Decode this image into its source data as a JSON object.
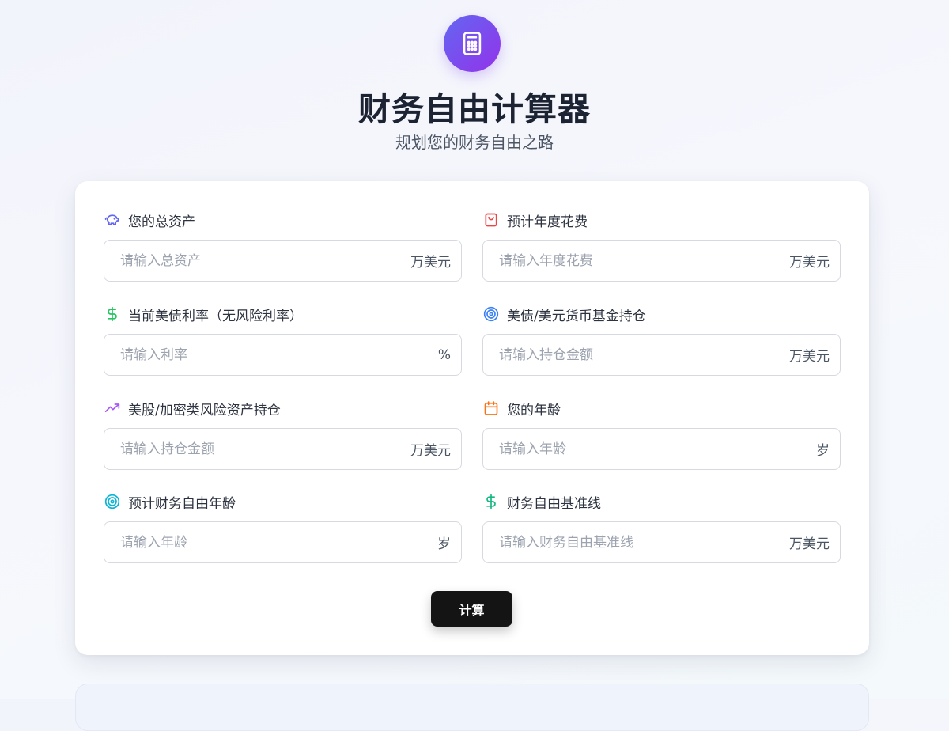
{
  "header": {
    "title": "财务自由计算器",
    "subtitle": "规划您的财务自由之路",
    "logo_icon": "calculator-icon"
  },
  "colors": {
    "accent_start": "#6366f1",
    "accent_end": "#9333ea",
    "button_bg": "#141414"
  },
  "form": {
    "fields": [
      {
        "label": "您的总资产",
        "placeholder": "请输入总资产",
        "unit": "万美元",
        "icon": "piggy-bank-icon",
        "icon_color": "#6366f1"
      },
      {
        "label": "预计年度花费",
        "placeholder": "请输入年度花费",
        "unit": "万美元",
        "icon": "shopping-bag-icon",
        "icon_color": "#ef4444"
      },
      {
        "label": "当前美债利率（无风险利率）",
        "placeholder": "请输入利率",
        "unit": "%",
        "icon": "dollar-icon",
        "icon_color": "#22c55e"
      },
      {
        "label": "美债/美元货币基金持仓",
        "placeholder": "请输入持仓金额",
        "unit": "万美元",
        "icon": "target-icon",
        "icon_color": "#3b82f6"
      },
      {
        "label": "美股/加密类风险资产持仓",
        "placeholder": "请输入持仓金额",
        "unit": "万美元",
        "icon": "trending-up-icon",
        "icon_color": "#a855f7"
      },
      {
        "label": "您的年龄",
        "placeholder": "请输入年龄",
        "unit": "岁",
        "icon": "calendar-icon",
        "icon_color": "#f97316"
      },
      {
        "label": "预计财务自由年龄",
        "placeholder": "请输入年龄",
        "unit": "岁",
        "icon": "target-icon",
        "icon_color": "#06b6d4"
      },
      {
        "label": "财务自由基准线",
        "placeholder": "请输入财务自由基准线",
        "unit": "万美元",
        "icon": "dollar-icon",
        "icon_color": "#10b981"
      }
    ],
    "submit_label": "计算"
  }
}
